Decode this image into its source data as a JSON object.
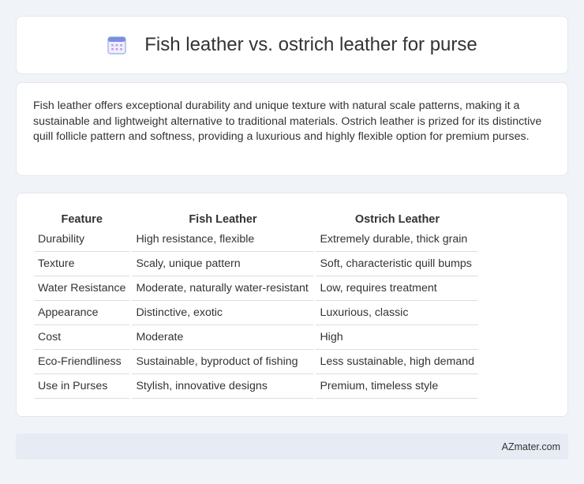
{
  "header": {
    "title": "Fish leather vs. ostrich leather for purse"
  },
  "intro": {
    "text": "Fish leather offers exceptional durability and unique texture with natural scale patterns, making it a sustainable and lightweight alternative to traditional materials. Ostrich leather is prized for its distinctive quill follicle pattern and softness, providing a luxurious and highly flexible option for premium purses."
  },
  "table": {
    "headers": [
      "Feature",
      "Fish Leather",
      "Ostrich Leather"
    ],
    "rows": [
      [
        "Durability",
        "High resistance, flexible",
        "Extremely durable, thick grain"
      ],
      [
        "Texture",
        "Scaly, unique pattern",
        "Soft, characteristic quill bumps"
      ],
      [
        "Water Resistance",
        "Moderate, naturally water-resistant",
        "Low, requires treatment"
      ],
      [
        "Appearance",
        "Distinctive, exotic",
        "Luxurious, classic"
      ],
      [
        "Cost",
        "Moderate",
        "High"
      ],
      [
        "Eco-Friendliness",
        "Sustainable, byproduct of fishing",
        "Less sustainable, high demand"
      ],
      [
        "Use in Purses",
        "Stylish, innovative designs",
        "Premium, timeless style"
      ]
    ]
  },
  "footer": {
    "brand": "AZmater.com"
  },
  "icon": {
    "name": "calendar-icon",
    "color": "#7b8fe0"
  }
}
